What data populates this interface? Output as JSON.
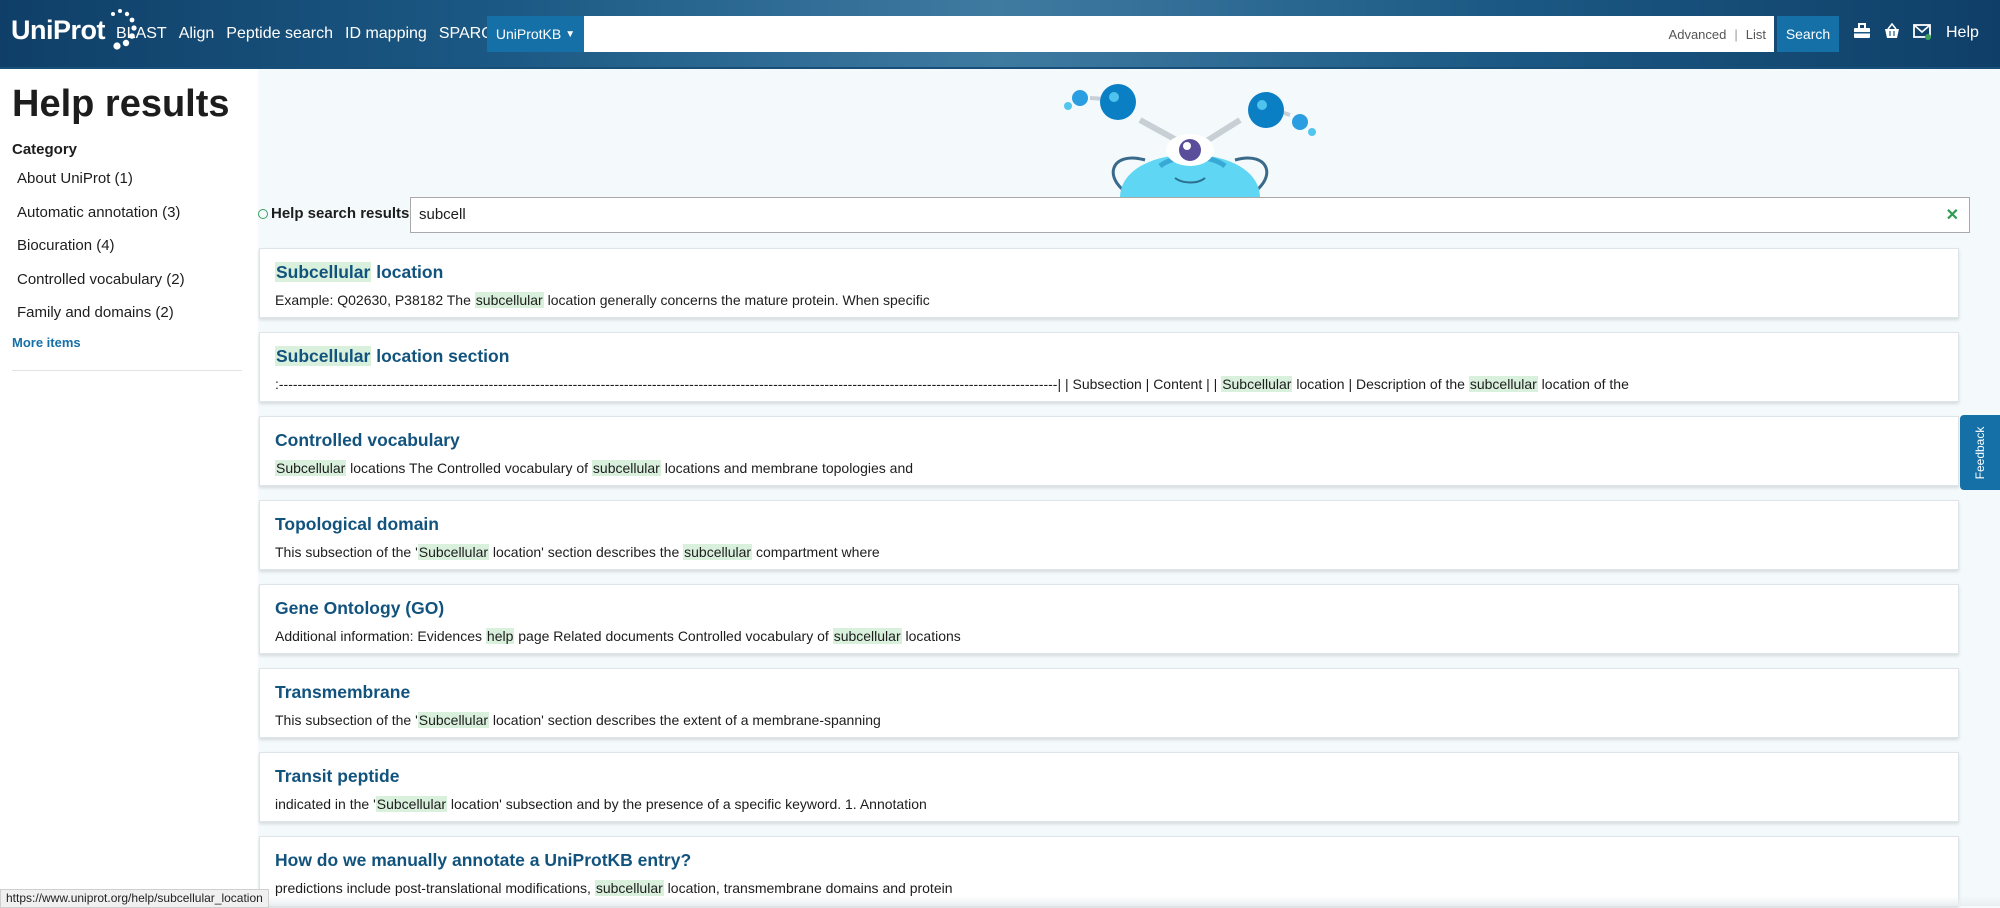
{
  "header": {
    "logo_text": "UniProt",
    "nav": [
      "BLAST",
      "Align",
      "Peptide search",
      "ID mapping",
      "SPARQL"
    ],
    "scope": "UniProtKB",
    "search_value": "",
    "advanced": "Advanced",
    "list": "List",
    "search_button": "Search",
    "help": "Help",
    "icons": [
      "toolbox-icon",
      "basket-icon",
      "mail-icon"
    ]
  },
  "sidebar": {
    "title": "Help results",
    "category_label": "Category",
    "categories": [
      "About UniProt (1)",
      "Automatic annotation (3)",
      "Biocuration (4)",
      "Controlled vocabulary (2)",
      "Family and domains (2)"
    ],
    "more_items": "More items"
  },
  "results_header": {
    "label": "Help search results",
    "query": "subcell"
  },
  "results": [
    {
      "title": [
        {
          "t": "Subcellular",
          "h": true
        },
        {
          "t": " location",
          "h": false
        }
      ],
      "snippet": [
        {
          "t": "Example: Q02630, P38182 The ",
          "h": false
        },
        {
          "t": "subcellular",
          "h": true
        },
        {
          "t": " location generally concerns the mature protein. When specific",
          "h": false
        }
      ]
    },
    {
      "title": [
        {
          "t": "Subcellular",
          "h": true
        },
        {
          "t": " location section",
          "h": false
        }
      ],
      "snippet": [
        {
          "t": ":-----------------------------------------------------------------------------------------------------------------------------------------------------------------------| | Subsection | Content | | ",
          "h": false
        },
        {
          "t": "Subcellular",
          "h": true
        },
        {
          "t": " location | Description of the ",
          "h": false
        },
        {
          "t": "subcellular",
          "h": true
        },
        {
          "t": " location of the",
          "h": false
        }
      ]
    },
    {
      "title": [
        {
          "t": "Controlled vocabulary",
          "h": false
        }
      ],
      "snippet": [
        {
          "t": "Subcellular",
          "h": true
        },
        {
          "t": " locations The Controlled vocabulary of ",
          "h": false
        },
        {
          "t": "subcellular",
          "h": true
        },
        {
          "t": " locations and membrane topologies and",
          "h": false
        }
      ]
    },
    {
      "title": [
        {
          "t": "Topological domain",
          "h": false
        }
      ],
      "snippet": [
        {
          "t": "This subsection of the '",
          "h": false
        },
        {
          "t": "Subcellular",
          "h": true
        },
        {
          "t": " location' section describes the ",
          "h": false
        },
        {
          "t": "subcellular",
          "h": true
        },
        {
          "t": " compartment where",
          "h": false
        }
      ]
    },
    {
      "title": [
        {
          "t": "Gene Ontology (GO)",
          "h": false
        }
      ],
      "snippet": [
        {
          "t": "Additional information: Evidences ",
          "h": false
        },
        {
          "t": "help",
          "h": true
        },
        {
          "t": " page Related documents Controlled vocabulary of ",
          "h": false
        },
        {
          "t": "subcellular",
          "h": true
        },
        {
          "t": " locations",
          "h": false
        }
      ]
    },
    {
      "title": [
        {
          "t": "Transmembrane",
          "h": false
        }
      ],
      "snippet": [
        {
          "t": "This subsection of the '",
          "h": false
        },
        {
          "t": "Subcellular",
          "h": true
        },
        {
          "t": " location' section describes the extent of a membrane-spanning",
          "h": false
        }
      ]
    },
    {
      "title": [
        {
          "t": "Transit peptide",
          "h": false
        }
      ],
      "snippet": [
        {
          "t": "indicated in the '",
          "h": false
        },
        {
          "t": "Subcellular",
          "h": true
        },
        {
          "t": " location' subsection and by the presence of a specific keyword. 1. Annotation",
          "h": false
        }
      ]
    },
    {
      "title": [
        {
          "t": "How do we manually annotate a UniProtKB entry?",
          "h": false
        }
      ],
      "snippet": [
        {
          "t": "predictions include post-translational modifications, ",
          "h": false
        },
        {
          "t": "subcellular",
          "h": true
        },
        {
          "t": " location, transmembrane domains and protein",
          "h": false
        }
      ]
    }
  ],
  "feedback": "Feedback",
  "status_url": "https://www.uniprot.org/help/subcellular_location",
  "colors": {
    "header_dark": "#0f3f68",
    "accent": "#1570a8",
    "title_link": "#12537e",
    "highlight": "#d9f0dc"
  }
}
